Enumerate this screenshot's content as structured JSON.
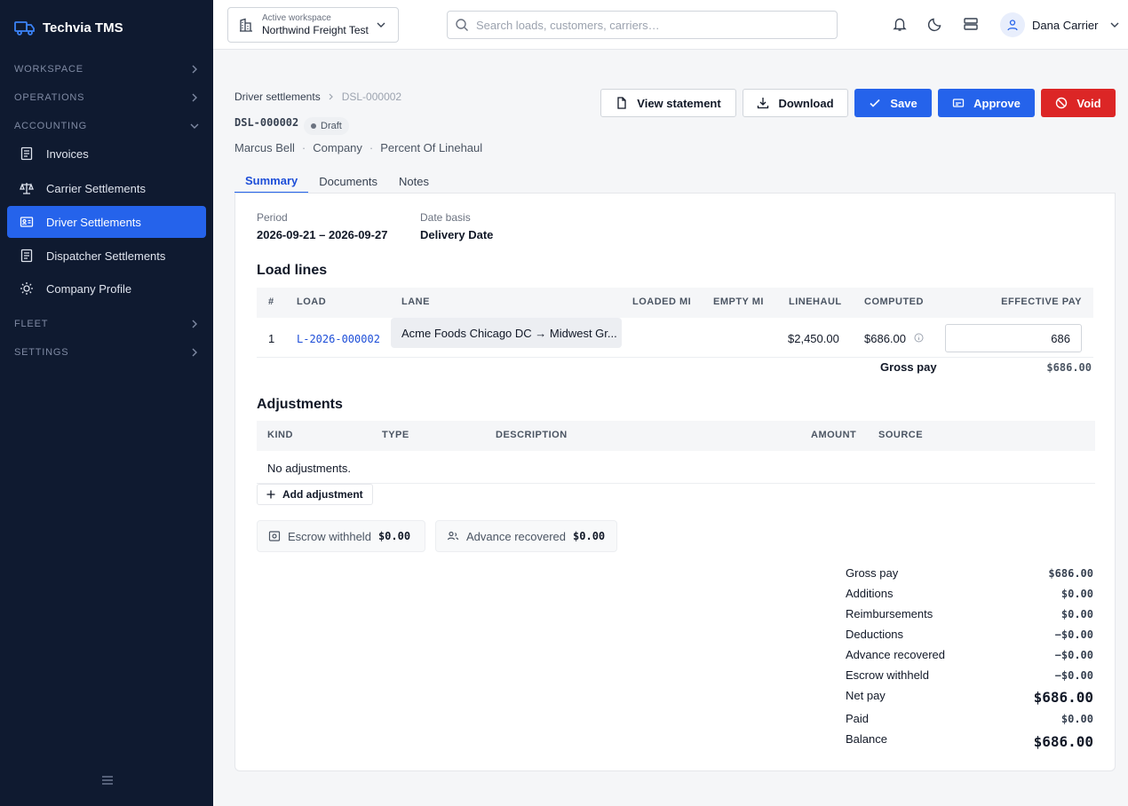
{
  "brand": {
    "name": "Techvia TMS"
  },
  "sidebar": {
    "sections": {
      "workspace": "WORKSPACE",
      "operations": "OPERATIONS",
      "accounting": "ACCOUNTING",
      "fleet": "FLEET",
      "settings": "SETTINGS"
    },
    "items": [
      {
        "label": "Invoices",
        "icon": "document-icon"
      },
      {
        "label": "Carrier Settlements",
        "icon": "scale-icon"
      },
      {
        "label": "Driver Settlements",
        "icon": "id-card-icon",
        "active": true
      },
      {
        "label": "Dispatcher Settlements",
        "icon": "document-icon"
      },
      {
        "label": "Company Profile",
        "icon": "sun-icon"
      }
    ]
  },
  "topbar": {
    "workspace_label": "Active workspace",
    "workspace_value": "Northwind Freight Test",
    "search_placeholder": "Search loads, customers, carriers…",
    "user_name": "Dana Carrier"
  },
  "header": {
    "breadcrumb_parent": "Driver settlements",
    "breadcrumb_current": "DSL-000002",
    "doc_id": "DSL-000002",
    "status": "Draft",
    "driver": "Marcus Bell",
    "driver_type": "Company",
    "pay_method": "Percent Of Linehaul",
    "sep": "·"
  },
  "actions": {
    "view_statement": "View statement",
    "download": "Download",
    "save": "Save",
    "approve": "Approve",
    "void": "Void"
  },
  "tabs": [
    "Summary",
    "Documents",
    "Notes"
  ],
  "period": {
    "period_label": "Period",
    "period_value": "2026-09-21 – 2026-09-27",
    "basis_label": "Date basis",
    "basis_value": "Delivery Date"
  },
  "load_lines": {
    "title": "Load lines",
    "columns": [
      "#",
      "LOAD",
      "LANE",
      "LOADED MI",
      "EMPTY MI",
      "LINEHAUL",
      "COMPUTED",
      "EFFECTIVE PAY"
    ],
    "rows": [
      {
        "num": "1",
        "load": "L-2026-000002",
        "lane": "Acme Foods Chicago DC → Midwest Gr...",
        "loaded_mi": "",
        "empty_mi": "",
        "linehaul": "$2,450.00",
        "computed": "$686.00",
        "effective_pay": "686"
      }
    ],
    "gross_label": "Gross pay",
    "gross_value": "$686.00"
  },
  "adjustments": {
    "title": "Adjustments",
    "columns": [
      "KIND",
      "TYPE",
      "DESCRIPTION",
      "AMOUNT",
      "SOURCE"
    ],
    "empty_text": "No adjustments.",
    "add_label": "Add adjustment"
  },
  "chips": {
    "escrow_label": "Escrow withheld",
    "escrow_value": "$0.00",
    "advance_label": "Advance recovered",
    "advance_value": "$0.00"
  },
  "summary": [
    {
      "label": "Gross pay",
      "value": "$686.00"
    },
    {
      "label": "Additions",
      "value": "$0.00"
    },
    {
      "label": "Reimbursements",
      "value": "$0.00"
    },
    {
      "label": "Deductions",
      "value": "−$0.00"
    },
    {
      "label": "Advance recovered",
      "value": "−$0.00"
    },
    {
      "label": "Escrow withheld",
      "value": "−$0.00"
    },
    {
      "label": "Net pay",
      "value": "$686.00",
      "big": true
    },
    {
      "label": "Paid",
      "value": "$0.00"
    },
    {
      "label": "Balance",
      "value": "$686.00",
      "big": true
    }
  ],
  "colors": {
    "sidebar": "#0f1a30",
    "accent": "#2563eb",
    "danger": "#dc2626"
  }
}
